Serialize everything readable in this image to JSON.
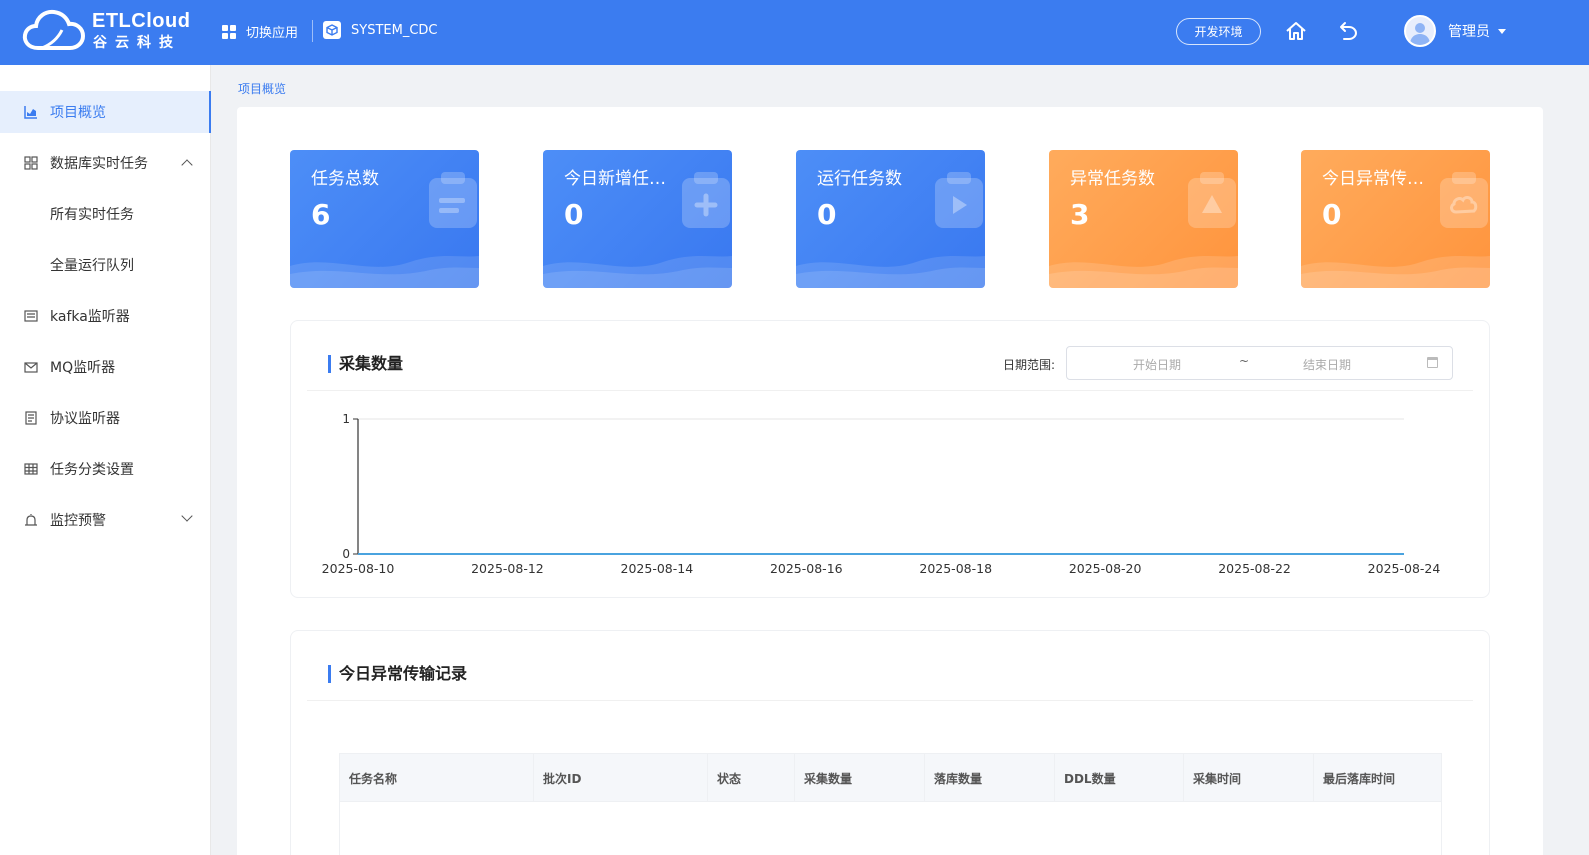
{
  "header": {
    "logo_title": "ETLCloud",
    "logo_subtitle": "谷云科技",
    "switch_app_label": "切换应用",
    "current_app": "SYSTEM_CDC",
    "env_label": "开发环境",
    "user_name": "管理员",
    "accent_color": "#3b7cf0"
  },
  "sidebar": {
    "items": [
      {
        "label": "项目概览",
        "icon": "chart-icon",
        "active": true
      },
      {
        "label": "数据库实时任务",
        "icon": "grid-icon",
        "expanded": true
      },
      {
        "label": "所有实时任务",
        "sub": true
      },
      {
        "label": "全量运行队列",
        "sub": true
      },
      {
        "label": "kafka监听器",
        "icon": "list-icon"
      },
      {
        "label": "MQ监听器",
        "icon": "mail-icon"
      },
      {
        "label": "协议监听器",
        "icon": "doc-icon"
      },
      {
        "label": "任务分类设置",
        "icon": "table-icon"
      },
      {
        "label": "监控预警",
        "icon": "alarm-icon",
        "expanded": false
      }
    ]
  },
  "breadcrumb": "项目概览",
  "cards": [
    {
      "title": "任务总数",
      "value": "6",
      "theme": "blue",
      "icon": "list-icon"
    },
    {
      "title": "今日新增任…",
      "value": "0",
      "theme": "blue",
      "icon": "plus-icon"
    },
    {
      "title": "运行任务数",
      "value": "0",
      "theme": "blue",
      "icon": "play-icon"
    },
    {
      "title": "异常任务数",
      "value": "3",
      "theme": "orange",
      "icon": "warning-icon"
    },
    {
      "title": "今日异常传…",
      "value": "0",
      "theme": "orange",
      "icon": "cloud-icon"
    }
  ],
  "collect_section": {
    "title": "采集数量",
    "date_label": "日期范围:",
    "start_placeholder": "开始日期",
    "separator": "~",
    "end_placeholder": "结束日期"
  },
  "chart_data": {
    "type": "line",
    "x": [
      "2025-08-10",
      "2025-08-11",
      "2025-08-12",
      "2025-08-13",
      "2025-08-14",
      "2025-08-15",
      "2025-08-16",
      "2025-08-17",
      "2025-08-18",
      "2025-08-19",
      "2025-08-20",
      "2025-08-21",
      "2025-08-22",
      "2025-08-23",
      "2025-08-24"
    ],
    "x_tick_labels": [
      "2025-08-10",
      "2025-08-12",
      "2025-08-14",
      "2025-08-16",
      "2025-08-18",
      "2025-08-20",
      "2025-08-22",
      "2025-08-24"
    ],
    "series": [
      {
        "values": [
          0,
          0,
          0,
          0,
          0,
          0,
          0,
          0,
          0,
          0,
          0,
          0,
          0,
          0,
          0
        ],
        "color": "#4aa3df"
      }
    ],
    "ylim": [
      0,
      1
    ],
    "y_ticks": [
      0,
      1
    ],
    "title": "",
    "xlabel": "",
    "ylabel": ""
  },
  "records_section": {
    "title": "今日异常传输记录",
    "columns": [
      "任务名称",
      "批次ID",
      "状态",
      "采集数量",
      "落库数量",
      "DDL数量",
      "采集时间",
      "最后落库时间"
    ]
  }
}
